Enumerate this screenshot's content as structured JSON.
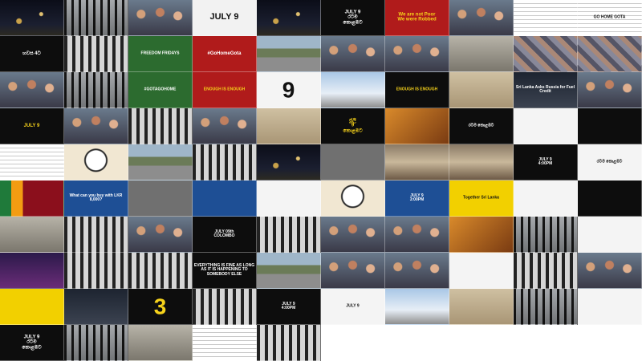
{
  "tiles": [
    {
      "bg": "t-night",
      "text": ""
    },
    {
      "bg": "t-gate",
      "text": ""
    },
    {
      "bg": "t-crowd",
      "text": ""
    },
    {
      "bg": "t-july",
      "text": "JULY 9",
      "color": "c-black",
      "size": "s-md"
    },
    {
      "bg": "t-night",
      "text": ""
    },
    {
      "bg": "t-black",
      "text": "JULY 9\nරටම\nකොළඹට",
      "color": "c-white",
      "size": "s-sm"
    },
    {
      "bg": "t-red",
      "text": "We are not Poor\nWe were Robbed",
      "color": "c-yellow",
      "size": "s-sm"
    },
    {
      "bg": "t-crowd",
      "text": ""
    },
    {
      "bg": "t-doc",
      "text": ""
    },
    {
      "bg": "t-doc",
      "text": "GO HOME GOTA",
      "color": "c-black",
      "size": "s-xs"
    },
    {
      "bg": "t-black",
      "text": "හවස 4ට",
      "color": "c-white",
      "size": "s-sm"
    },
    {
      "bg": "t-gate2",
      "text": ""
    },
    {
      "bg": "t-green",
      "text": "FREEDOM FRIDAYS",
      "color": "c-white",
      "size": "s-xs"
    },
    {
      "bg": "t-red",
      "text": "#GoHomeGota",
      "color": "c-white",
      "size": "s-sm"
    },
    {
      "bg": "t-street",
      "text": ""
    },
    {
      "bg": "t-crowd",
      "text": ""
    },
    {
      "bg": "t-crowd",
      "text": ""
    },
    {
      "bg": "t-room",
      "text": ""
    },
    {
      "bg": "t-collage",
      "text": ""
    },
    {
      "bg": "t-collage",
      "text": ""
    },
    {
      "bg": "t-crowd",
      "text": ""
    },
    {
      "bg": "t-gate",
      "text": ""
    },
    {
      "bg": "t-green",
      "text": "#GOTAGOHOME",
      "color": "c-white",
      "size": "s-xs"
    },
    {
      "bg": "t-red",
      "text": "ENOUGH IS ENOUGH",
      "color": "c-yellow",
      "size": "s-xs"
    },
    {
      "bg": "t-white",
      "text": "9",
      "color": "c-black",
      "size": "s-lg"
    },
    {
      "bg": "t-sky",
      "text": ""
    },
    {
      "bg": "t-black",
      "text": "ENOUGH IS ENOUGH",
      "color": "c-yellow",
      "size": "s-xs"
    },
    {
      "bg": "t-sand",
      "text": ""
    },
    {
      "bg": "t-dark2",
      "text": "Sri Lanka Asks Russia for Fuel Credit",
      "color": "c-white",
      "size": "s-xs"
    },
    {
      "bg": "t-crowd",
      "text": ""
    },
    {
      "bg": "t-black",
      "text": "JULY 9",
      "color": "c-yellow",
      "size": "s-sm"
    },
    {
      "bg": "t-crowd",
      "text": ""
    },
    {
      "bg": "t-gate2",
      "text": ""
    },
    {
      "bg": "t-crowd",
      "text": ""
    },
    {
      "bg": "t-sand",
      "text": ""
    },
    {
      "bg": "t-black",
      "text": "ජූලි\n9\nකොළඹට",
      "color": "c-yellow",
      "size": "s-sm"
    },
    {
      "bg": "t-warm",
      "text": ""
    },
    {
      "bg": "t-black",
      "text": "රටම කොළඹට",
      "color": "c-white",
      "size": "s-xs"
    },
    {
      "bg": "t-white",
      "text": "",
      "color": "c-black",
      "size": "s-xs"
    },
    {
      "bg": "t-black",
      "text": "",
      "color": "c-white",
      "size": "s-xs"
    },
    {
      "bg": "t-doc",
      "text": ""
    },
    {
      "bg": "t-cartoon",
      "text": ""
    },
    {
      "bg": "t-street",
      "text": ""
    },
    {
      "bg": "t-gate2",
      "text": ""
    },
    {
      "bg": "t-night",
      "text": ""
    },
    {
      "bg": "t-gray",
      "text": ""
    },
    {
      "bg": "t-hall",
      "text": ""
    },
    {
      "bg": "t-hall",
      "text": ""
    },
    {
      "bg": "t-black",
      "text": "JULY 9\n4:00PM",
      "color": "c-white",
      "size": "s-xs"
    },
    {
      "bg": "t-white",
      "text": "රටම කොළඹට",
      "color": "c-black",
      "size": "s-xs"
    },
    {
      "bg": "t-flag",
      "text": ""
    },
    {
      "bg": "t-blue",
      "text": "What can you buy with LKR 8,000?",
      "color": "c-white",
      "size": "s-xs"
    },
    {
      "bg": "t-gray",
      "text": ""
    },
    {
      "bg": "t-blue",
      "text": ""
    },
    {
      "bg": "t-white",
      "text": ""
    },
    {
      "bg": "t-cartoon",
      "text": ""
    },
    {
      "bg": "t-blue",
      "text": "JULY 9\n3:00PM",
      "color": "c-white",
      "size": "s-xs"
    },
    {
      "bg": "t-yellow",
      "text": "Together Sri Lanka",
      "color": "c-black",
      "size": "s-xs"
    },
    {
      "bg": "t-white",
      "text": "",
      "color": "c-black",
      "size": "s-xs"
    },
    {
      "bg": "t-black",
      "text": "",
      "color": "c-white",
      "size": "s-xs"
    },
    {
      "bg": "t-room",
      "text": ""
    },
    {
      "bg": "t-gate2",
      "text": ""
    },
    {
      "bg": "t-crowd",
      "text": ""
    },
    {
      "bg": "t-black",
      "text": "JULY 09th\nCOLOMBO",
      "color": "c-white",
      "size": "s-xs"
    },
    {
      "bg": "t-gate2",
      "text": ""
    },
    {
      "bg": "t-crowd",
      "text": ""
    },
    {
      "bg": "t-crowd",
      "text": ""
    },
    {
      "bg": "t-warm",
      "text": ""
    },
    {
      "bg": "t-gate",
      "text": ""
    },
    {
      "bg": "t-white",
      "text": ""
    },
    {
      "bg": "t-purple",
      "text": ""
    },
    {
      "bg": "t-gate2",
      "text": ""
    },
    {
      "bg": "t-gate2",
      "text": ""
    },
    {
      "bg": "t-black",
      "text": "EVERYTHING IS FINE AS LONG AS IT IS HAPPENING TO SOMEBODY ELSE",
      "color": "c-white",
      "size": "s-xs"
    },
    {
      "bg": "t-street",
      "text": ""
    },
    {
      "bg": "t-crowd",
      "text": ""
    },
    {
      "bg": "t-crowd",
      "text": ""
    },
    {
      "bg": "t-white",
      "text": "",
      "color": "c-black",
      "size": "s-xs"
    },
    {
      "bg": "t-gate2",
      "text": ""
    },
    {
      "bg": "t-crowd",
      "text": ""
    },
    {
      "bg": "t-yellow",
      "text": "",
      "color": "c-black",
      "size": "s-xs"
    },
    {
      "bg": "t-dark2",
      "text": ""
    },
    {
      "bg": "t-black",
      "text": "3",
      "color": "c-yellow",
      "size": "s-lg"
    },
    {
      "bg": "t-gate2",
      "text": ""
    },
    {
      "bg": "t-black",
      "text": "JULY 9\n4:00PM",
      "color": "c-white",
      "size": "s-xs"
    },
    {
      "bg": "t-white",
      "text": "JULY 9",
      "color": "c-black",
      "size": "s-xs"
    },
    {
      "bg": "t-sky",
      "text": ""
    },
    {
      "bg": "t-sand",
      "text": ""
    },
    {
      "bg": "t-gate",
      "text": ""
    },
    {
      "bg": "t-white",
      "text": "",
      "color": "c-black",
      "size": "s-xs"
    },
    {
      "bg": "t-black",
      "text": "JULY 9\nරටම\nකොළඹට",
      "color": "c-white",
      "size": "s-sm"
    },
    {
      "bg": "t-gate",
      "text": ""
    },
    {
      "bg": "t-room",
      "text": ""
    },
    {
      "bg": "t-doc",
      "text": ""
    },
    {
      "bg": "t-gate2",
      "text": ""
    }
  ]
}
